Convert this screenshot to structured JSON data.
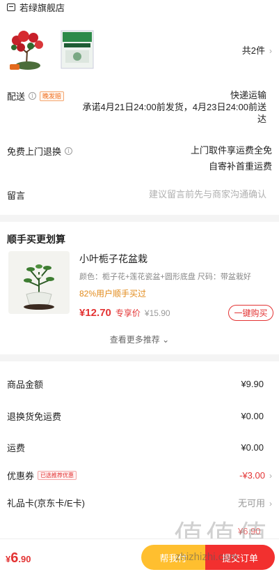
{
  "shop": {
    "name": "若绿旗舰店",
    "icon": "shop-icon"
  },
  "goods": {
    "count_label": "共2件",
    "chevron": "›"
  },
  "delivery": {
    "label": "配送",
    "tag": "晚发赔",
    "method": "快递运输",
    "promise_line1": "承诺4月21日24:00前发货，4月23日24:00前送",
    "promise_line2": "达"
  },
  "return_service": {
    "label": "免费上门退换",
    "line1": "上门取件享运费全免",
    "line2": "自寄补首重运费"
  },
  "message": {
    "label": "留言",
    "placeholder": "建议留言前先与商家沟通确认"
  },
  "recommend": {
    "section_title": "顺手买更划算",
    "item": {
      "name": "小叶栀子花盆栽",
      "spec": "颜色：栀子花+莲花瓷盆+圆形底盘   尺码：带盆栽好",
      "buyers": "82%用户顺手买过",
      "price": "¥12.70",
      "price_label": "专享价",
      "original_price": "¥15.90",
      "buy_label": "一键购买"
    },
    "more_label": "查看更多推荐 ⌄"
  },
  "summary": {
    "goods_amount_label": "商品金额",
    "goods_amount": "¥9.90",
    "return_free_label": "退换货免运费",
    "return_free": "¥0.00",
    "shipping_label": "运费",
    "shipping": "¥0.00",
    "coupon_label": "优惠券",
    "coupon_tag": "已选推荐优惠",
    "coupon": "-¥3.00",
    "giftcard_label": "礼品卡(京东卡/E卡)",
    "giftcard": "无可用",
    "partial_total": "¥6.90"
  },
  "footer": {
    "total_symbol": "¥",
    "total_int": "6",
    "total_dec": ".90",
    "help_label": "帮我付",
    "pay_label": "提交订单"
  },
  "watermark": {
    "text": "值值值",
    "url": "zhizhizhi.com"
  },
  "colors": {
    "accent": "#e33333",
    "help": "#ffbf2f",
    "tag": "#f06e1e"
  }
}
